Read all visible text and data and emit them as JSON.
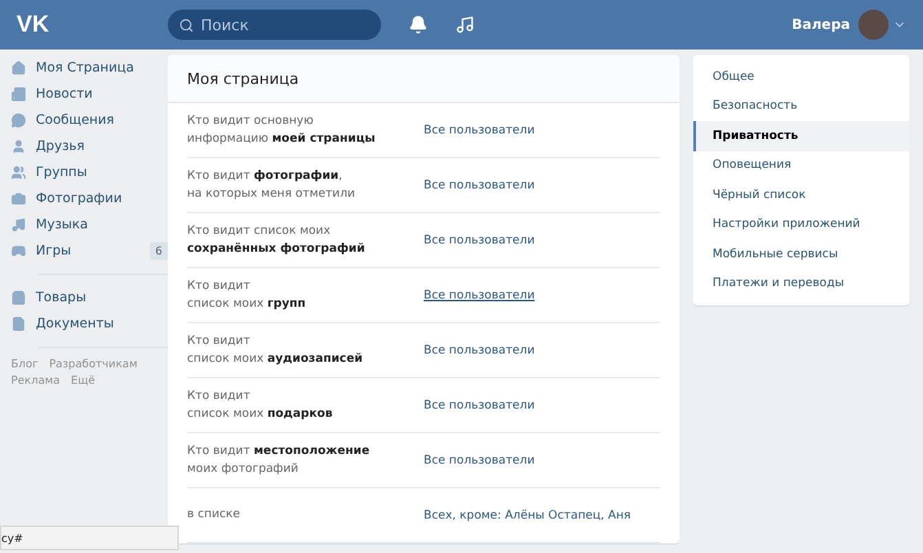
{
  "header": {
    "logo": "VK",
    "search": {
      "placeholder": "Поиск"
    },
    "user": {
      "name": "Валера"
    }
  },
  "sidebar": {
    "items": [
      {
        "label": "Моя Страница"
      },
      {
        "label": "Новости"
      },
      {
        "label": "Сообщения"
      },
      {
        "label": "Друзья"
      },
      {
        "label": "Группы"
      },
      {
        "label": "Фотографии"
      },
      {
        "label": "Музыка"
      },
      {
        "label": "Игры",
        "badge": "6"
      }
    ],
    "items_2": [
      {
        "label": "Товары"
      },
      {
        "label": "Документы"
      }
    ],
    "footer_links": [
      "Блог",
      "Разработчикам",
      "Реклама",
      "Ещё"
    ]
  },
  "main": {
    "title": "Моя страница",
    "rows": [
      {
        "label": "Кто видит основную\nинформацию **моей страницы**",
        "value": "Все пользователи",
        "hovered": false
      },
      {
        "label": "Кто видит **фотографии**,\nна которых меня отметили",
        "value": "Все пользователи",
        "hovered": false
      },
      {
        "label": "Кто видит список моих\n**сохранённых фотографий**",
        "value": "Все пользователи",
        "hovered": false
      },
      {
        "label": "Кто видит\nсписок моих **групп**",
        "value": "Все пользователи",
        "hovered": true
      },
      {
        "label": "Кто видит\nсписок моих **аудиозаписей**",
        "value": "Все пользователи",
        "hovered": false
      },
      {
        "label": "Кто видит\nсписок моих **подарков**",
        "value": "Все пользователи",
        "hovered": false
      },
      {
        "label": "Кто видит **местоположение**\nмоих фотографий",
        "value": "Все пользователи",
        "hovered": false
      },
      {
        "label": "в списке",
        "value": "Всех, кроме: Алёны Остапец, Аня",
        "hovered": false
      }
    ]
  },
  "settings_menu": {
    "items": [
      {
        "label": "Общее",
        "selected": false
      },
      {
        "label": "Безопасность",
        "selected": false
      },
      {
        "label": "Приватность",
        "selected": true
      },
      {
        "label": "Оповещения",
        "selected": false
      },
      {
        "label": "Чёрный список",
        "selected": false
      },
      {
        "label": "Настройки приложений",
        "selected": false
      },
      {
        "label": "Мобильные сервисы",
        "selected": false
      },
      {
        "label": "Платежи и переводы",
        "selected": false
      }
    ]
  },
  "status_bar": {
    "url": "cy#"
  }
}
